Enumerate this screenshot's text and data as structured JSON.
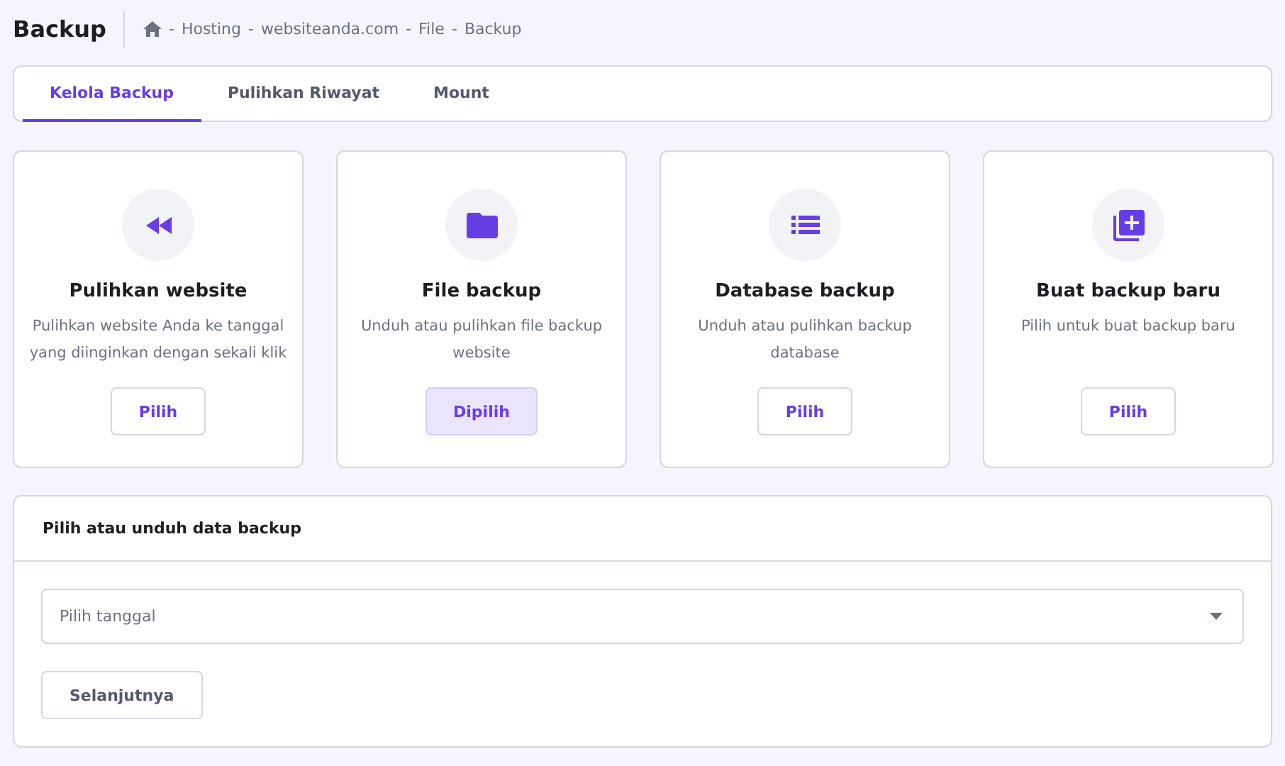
{
  "page_title": "Backup",
  "breadcrumb": [
    "Hosting",
    "websiteanda.com",
    "File",
    "Backup"
  ],
  "breadcrumb_separator": "-",
  "tabs": [
    {
      "label": "Kelola Backup",
      "selected": true
    },
    {
      "label": "Pulihkan Riwayat",
      "selected": false
    },
    {
      "label": "Mount",
      "selected": false
    }
  ],
  "cards": [
    {
      "kind": "restore",
      "title": "Pulihkan website",
      "description": "Pulihkan website Anda ke tanggal yang diinginkan dengan sekali klik",
      "button": "Pilih",
      "selected": false
    },
    {
      "kind": "files",
      "title": "File backup",
      "description": "Unduh atau pulihkan file backup website",
      "button": "Dipilih",
      "selected": true
    },
    {
      "kind": "database",
      "title": "Database backup",
      "description": "Unduh atau pulihkan backup database",
      "button": "Pilih",
      "selected": false
    },
    {
      "kind": "new",
      "title": "Buat backup baru",
      "description": "Pilih untuk buat backup baru",
      "button": "Pilih",
      "selected": false
    }
  ],
  "panel": {
    "title": "Pilih atau unduh data backup",
    "select": {
      "placeholder": "Pilih tanggal"
    },
    "button": "Selanjutnya"
  }
}
